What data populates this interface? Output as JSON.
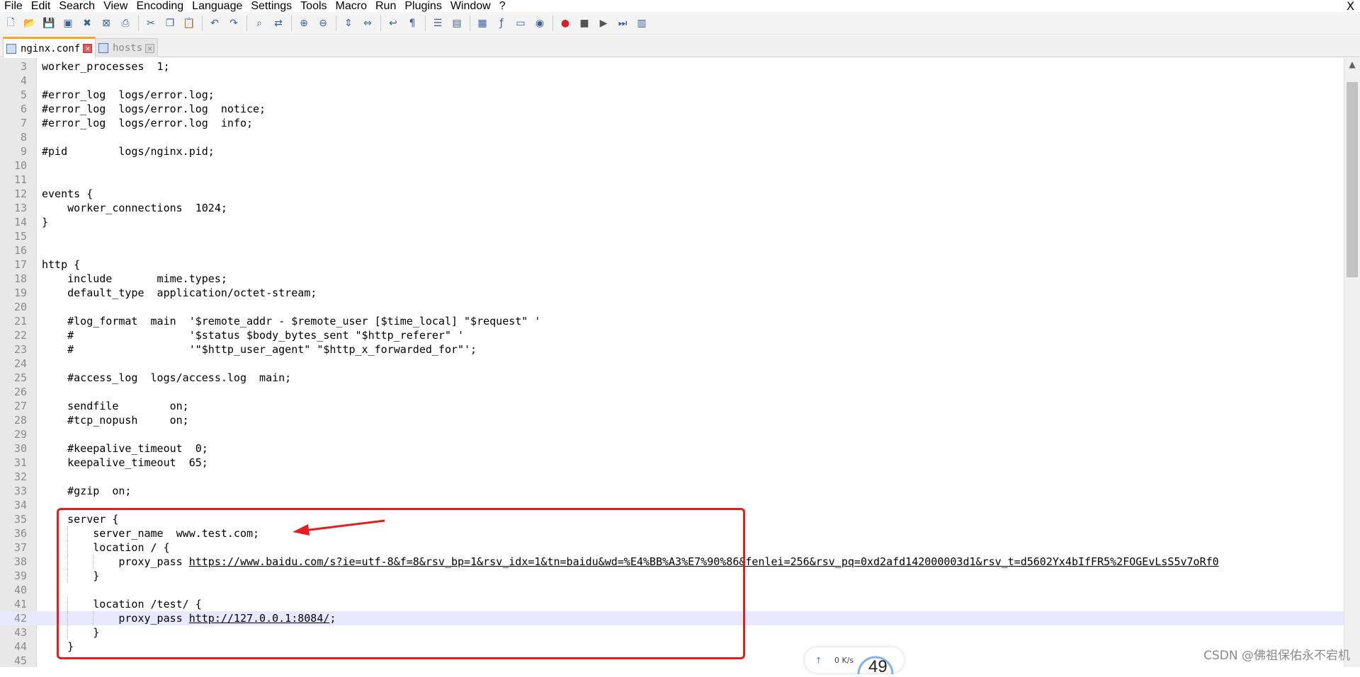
{
  "menu": [
    "File",
    "Edit",
    "Search",
    "View",
    "Encoding",
    "Language",
    "Settings",
    "Tools",
    "Macro",
    "Run",
    "Plugins",
    "Window",
    "?"
  ],
  "menu_close": "X",
  "toolbar": [
    "new-file-icon",
    "open-file-icon",
    "save-icon",
    "save-all-icon",
    "close-icon",
    "close-all-icon",
    "print-icon",
    "cut-icon",
    "copy-icon",
    "paste-icon",
    "undo-icon",
    "redo-icon",
    "find-icon",
    "replace-icon",
    "zoom-in-icon",
    "zoom-out-icon",
    "sync-vertical-icon",
    "sync-horizontal-icon",
    "word-wrap-icon",
    "show-all-chars-icon",
    "indent-guide-icon",
    "udl-icon",
    "doc-map-icon",
    "function-list-icon",
    "folder-workspace-icon",
    "monitoring-icon",
    "record-macro-icon",
    "stop-macro-icon",
    "play-macro-icon",
    "run-macro-multiple-icon",
    "save-macro-icon"
  ],
  "tabs": [
    {
      "label": "nginx.conf",
      "active": true
    },
    {
      "label": "hosts",
      "active": false
    }
  ],
  "tab_close": "✕",
  "current_line": 42,
  "lines": [
    {
      "n": "3",
      "text": "worker_processes  1;"
    },
    {
      "n": "4",
      "text": ""
    },
    {
      "n": "5",
      "text": "#error_log  logs/error.log;"
    },
    {
      "n": "6",
      "text": "#error_log  logs/error.log  notice;"
    },
    {
      "n": "7",
      "text": "#error_log  logs/error.log  info;"
    },
    {
      "n": "8",
      "text": ""
    },
    {
      "n": "9",
      "text": "#pid        logs/nginx.pid;"
    },
    {
      "n": "10",
      "text": ""
    },
    {
      "n": "11",
      "text": ""
    },
    {
      "n": "12",
      "text": "events {"
    },
    {
      "n": "13",
      "text": "    worker_connections  1024;"
    },
    {
      "n": "14",
      "text": "}"
    },
    {
      "n": "15",
      "text": ""
    },
    {
      "n": "16",
      "text": ""
    },
    {
      "n": "17",
      "text": "http {"
    },
    {
      "n": "18",
      "text": "    include       mime.types;"
    },
    {
      "n": "19",
      "text": "    default_type  application/octet-stream;"
    },
    {
      "n": "20",
      "text": ""
    },
    {
      "n": "21",
      "text": "    #log_format  main  '$remote_addr - $remote_user [$time_local] \"$request\" '"
    },
    {
      "n": "22",
      "text": "    #                  '$status $body_bytes_sent \"$http_referer\" '"
    },
    {
      "n": "23",
      "text": "    #                  '\"$http_user_agent\" \"$http_x_forwarded_for\"';"
    },
    {
      "n": "24",
      "text": ""
    },
    {
      "n": "25",
      "text": "    #access_log  logs/access.log  main;"
    },
    {
      "n": "26",
      "text": ""
    },
    {
      "n": "27",
      "text": "    sendfile        on;"
    },
    {
      "n": "28",
      "text": "    #tcp_nopush     on;"
    },
    {
      "n": "29",
      "text": ""
    },
    {
      "n": "30",
      "text": "    #keepalive_timeout  0;"
    },
    {
      "n": "31",
      "text": "    keepalive_timeout  65;"
    },
    {
      "n": "32",
      "text": ""
    },
    {
      "n": "33",
      "text": "    #gzip  on;"
    },
    {
      "n": "34",
      "text": ""
    },
    {
      "n": "35",
      "text": "    server {"
    },
    {
      "n": "36",
      "text": "        server_name  www.test.com;"
    },
    {
      "n": "37",
      "text": "        location / {"
    },
    {
      "n": "38",
      "prefix": "            proxy_pass ",
      "link": "https://www.baidu.com/s?ie=utf-8&f=8&rsv_bp=1&rsv_idx=1&tn=baidu&wd=%E4%BB%A3%E7%90%86&fenlei=256&rsv_pq=0xd2afd142000003d1&rsv_t=d5602Yx4bIfFR5%2FOGEvLsS5v7oRf0",
      "suffix": ""
    },
    {
      "n": "39",
      "text": "        }"
    },
    {
      "n": "40",
      "text": ""
    },
    {
      "n": "41",
      "text": "        location /test/ {"
    },
    {
      "n": "42",
      "prefix": "            proxy_pass ",
      "link": "http://127.0.0.1:8084/",
      "suffix": ";"
    },
    {
      "n": "43",
      "text": "        }"
    },
    {
      "n": "44",
      "text": "    }"
    },
    {
      "n": "45",
      "text": ""
    }
  ],
  "scroll_up": "▲",
  "watermark": "CSDN @佛祖保佑永不宕机",
  "net_widget": {
    "arrow": "↑",
    "rate": "0  K/s",
    "value": "49"
  },
  "colors": {
    "annotation_red": "#e51d1d",
    "current_line": "#e8e8ff",
    "active_tab_accent": "#f5a623"
  }
}
